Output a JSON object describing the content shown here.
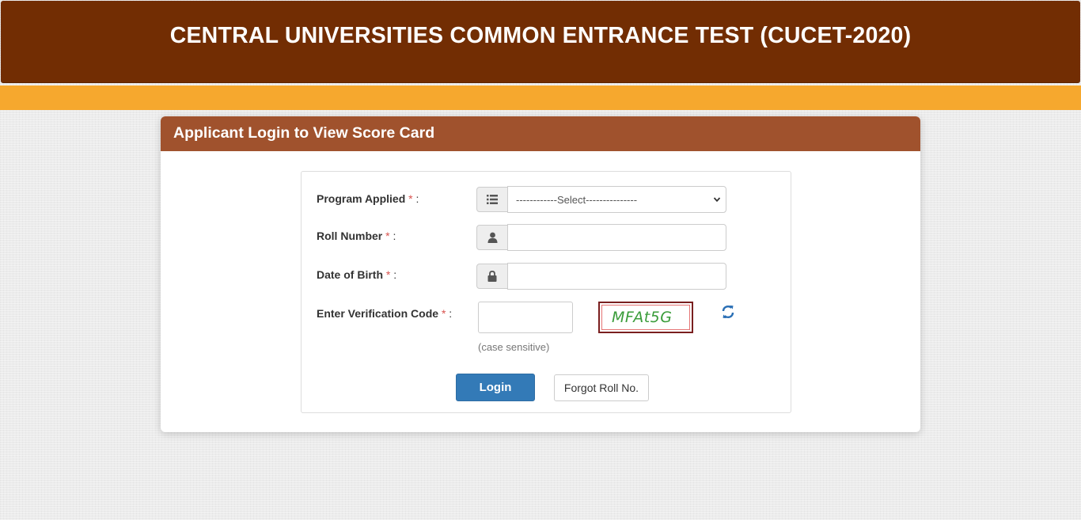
{
  "header": {
    "title": "CENTRAL UNIVERSITIES COMMON ENTRANCE TEST (CUCET-2020)"
  },
  "panel": {
    "title": "Applicant Login to View Score Card"
  },
  "form": {
    "program": {
      "label": "Program Applied",
      "required_mark": "*",
      "colon": ":",
      "icon": "list-icon",
      "selected": "------------Select---------------"
    },
    "roll_number": {
      "label": "Roll Number",
      "required_mark": "*",
      "colon": ":",
      "icon": "user-icon",
      "value": ""
    },
    "dob": {
      "label": "Date of Birth",
      "required_mark": "*",
      "colon": ":",
      "icon": "lock-icon",
      "value": ""
    },
    "verification": {
      "label": "Enter Verification Code",
      "required_mark": "*",
      "colon": ":",
      "value": "",
      "captcha_text": "MFAt5G",
      "hint": "(case sensitive)",
      "refresh_icon": "refresh-icon"
    }
  },
  "buttons": {
    "login": "Login",
    "forgot": "Forgot Roll No."
  },
  "colors": {
    "header_bg": "#722d03",
    "band": "#f6a82e",
    "panel_heading": "#a0522d",
    "primary_button": "#337ab7",
    "captcha_text": "#3a9c3a"
  }
}
